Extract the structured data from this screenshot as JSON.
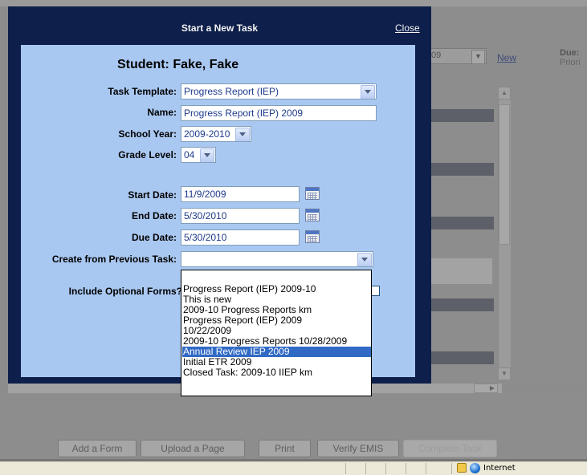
{
  "background": {
    "year_select_value": "09",
    "new_link": "New",
    "due_label": "Due:",
    "priority_label": "Priori",
    "buttons": [
      {
        "label": "Add a Form"
      },
      {
        "label": "Upload a Page"
      },
      {
        "label": "Print"
      },
      {
        "label": "Verify EMIS"
      },
      {
        "label": "Complete Task"
      }
    ]
  },
  "modal": {
    "title": "Start a New Task",
    "close_label": "Close",
    "student_label": "Student:",
    "student_name": "Fake, Fake",
    "fields": {
      "task_template": {
        "label": "Task Template:",
        "value": "Progress Report (IEP)"
      },
      "name": {
        "label": "Name:",
        "value": "Progress Report (IEP) 2009"
      },
      "school_year": {
        "label": "School Year:",
        "value": "2009-2010"
      },
      "grade_level": {
        "label": "Grade Level:",
        "value": "04"
      },
      "start_date": {
        "label": "Start Date:",
        "value": "11/9/2009"
      },
      "end_date": {
        "label": "End Date:",
        "value": "5/30/2010"
      },
      "due_date": {
        "label": "Due Date:",
        "value": "5/30/2010"
      },
      "previous_task": {
        "label": "Create from Previous Task:",
        "value": ""
      },
      "optional_forms": {
        "label": "Include Optional Forms?",
        "checked": false
      }
    },
    "previous_task_options": [
      "Progress Report (IEP) 2009-10",
      "This is new",
      "2009-10 Progress Reports km",
      "Progress Report (IEP) 2009",
      "10/22/2009",
      "2009-10 Progress Reports 10/28/2009",
      "Annual Review IEP 2009",
      "Initial ETR 2009",
      "Closed Task: 2009-10 IIEP km"
    ],
    "selected_option": "Annual Review IEP 2009"
  },
  "statusbar": {
    "zone_text": "Internet"
  },
  "colors": {
    "modal_dark": "#0d1f4a",
    "modal_light": "#a9c8f1",
    "selection": "#316ac5"
  }
}
